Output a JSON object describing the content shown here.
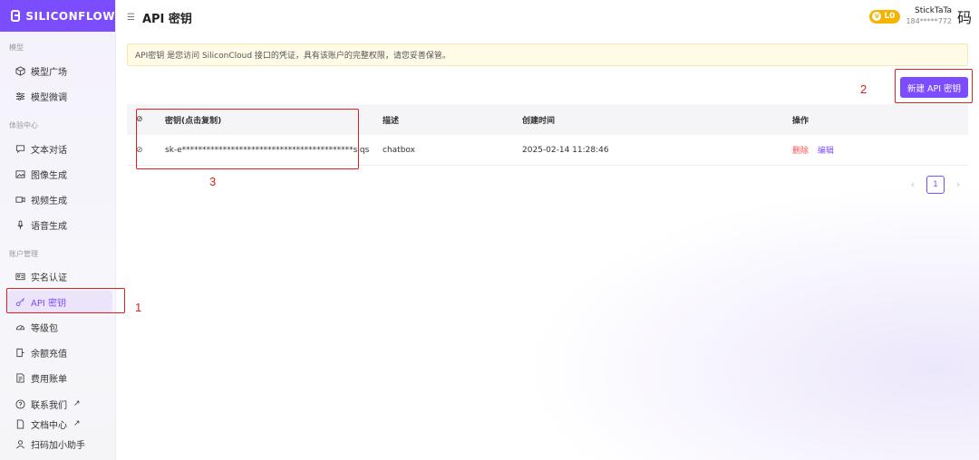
{
  "app": {
    "brand": "SILICONFLOW",
    "page_title": "API 密钥"
  },
  "user": {
    "level": "L0",
    "name": "StickTaTa",
    "phone": "184*****772",
    "qr_glyph": "码"
  },
  "sidebar": {
    "sections": [
      {
        "title": "模型"
      },
      {
        "title": "体验中心"
      },
      {
        "title": "账户管理"
      }
    ],
    "items": [
      {
        "label": "模型广场",
        "icon": "cube-icon"
      },
      {
        "label": "模型微调",
        "icon": "sliders-icon"
      },
      {
        "label": "文本对话",
        "icon": "chat-icon"
      },
      {
        "label": "图像生成",
        "icon": "image-icon"
      },
      {
        "label": "视频生成",
        "icon": "video-icon"
      },
      {
        "label": "语音生成",
        "icon": "mic-icon"
      },
      {
        "label": "实名认证",
        "icon": "id-card-icon"
      },
      {
        "label": "API 密钥",
        "icon": "key-icon",
        "active": true
      },
      {
        "label": "等级包",
        "icon": "gauge-icon"
      },
      {
        "label": "余额充值",
        "icon": "wallet-icon"
      },
      {
        "label": "费用账单",
        "icon": "bill-icon"
      },
      {
        "label": "联系我们",
        "icon": "help-icon",
        "external": true
      },
      {
        "label": "文档中心",
        "icon": "doc-icon",
        "external": true
      },
      {
        "label": "扫码加小助手",
        "icon": "user-icon"
      }
    ],
    "external_mark": "↗"
  },
  "notice": "API密钥 是您访问 SiliconCloud 接口的凭证，具有该账户的完整权限，请您妥善保管。",
  "new_key_button": "新建 API 密钥",
  "table": {
    "columns": [
      "密钥(点击复制)",
      "描述",
      "创建时间",
      "操作"
    ],
    "rows": [
      {
        "key": "sk-e******************************************slqs",
        "desc": "chatbox",
        "created": "2025-02-14 11:28:46",
        "delete": "删除",
        "edit": "编辑"
      }
    ]
  },
  "pagination": {
    "current": "1",
    "prev": "‹",
    "next": "›"
  },
  "annotations": [
    "1",
    "2",
    "3"
  ],
  "colors": {
    "accent": "#7c4dff",
    "danger": "#ff4d4f",
    "annotation": "#e02020",
    "notice_bg": "#fffbe6"
  }
}
